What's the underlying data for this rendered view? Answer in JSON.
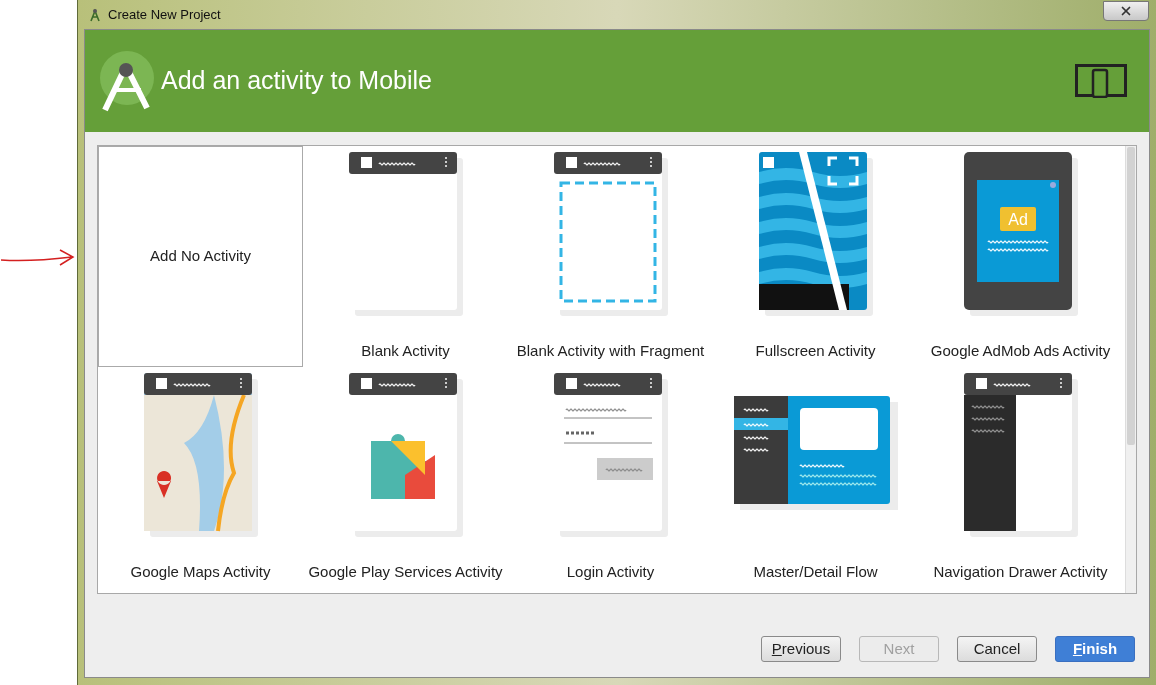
{
  "window": {
    "title": "Create New Project"
  },
  "header": {
    "title": "Add an activity to Mobile"
  },
  "activities": [
    {
      "kind": "none",
      "label": "Add No Activity",
      "selected": true
    },
    {
      "kind": "blank",
      "label": "Blank Activity",
      "selected": false
    },
    {
      "kind": "fragment",
      "label": "Blank Activity with Fragment",
      "selected": false
    },
    {
      "kind": "fullscreen",
      "label": "Fullscreen Activity",
      "selected": false
    },
    {
      "kind": "admob",
      "label": "Google AdMob Ads Activity",
      "selected": false,
      "badge": "Ad"
    },
    {
      "kind": "maps",
      "label": "Google Maps Activity",
      "selected": false
    },
    {
      "kind": "play",
      "label": "Google Play Services Activity",
      "selected": false
    },
    {
      "kind": "login",
      "label": "Login Activity",
      "selected": false
    },
    {
      "kind": "masterdetail",
      "label": "Master/Detail Flow",
      "selected": false
    },
    {
      "kind": "drawer",
      "label": "Navigation Drawer Activity",
      "selected": false
    }
  ],
  "buttons": [
    {
      "label": "Previous",
      "kind": "default",
      "mnemonic": true,
      "disabled": false
    },
    {
      "label": "Next",
      "kind": "default",
      "mnemonic": false,
      "disabled": true
    },
    {
      "label": "Cancel",
      "kind": "default",
      "mnemonic": false,
      "disabled": false
    },
    {
      "label": "Finish",
      "kind": "primary",
      "mnemonic": true,
      "disabled": false
    }
  ]
}
